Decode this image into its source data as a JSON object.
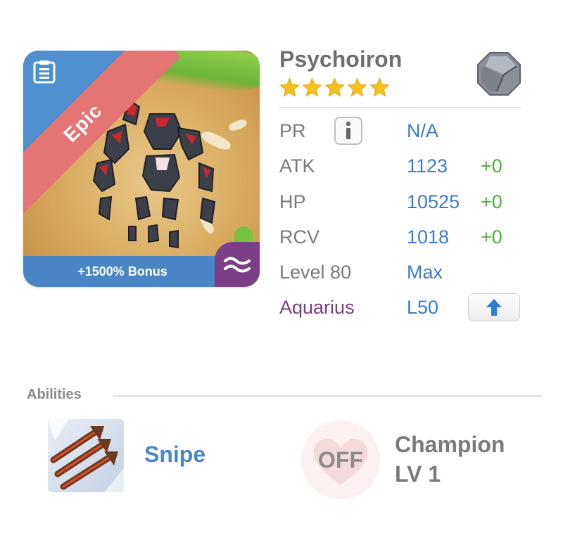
{
  "card": {
    "rarity": "Epic",
    "bonus": "+1500% Bonus",
    "element_icon": "water-waves-icon",
    "colors": {
      "rarity_ribbon": "#e57474",
      "corner": "#4d8fcf",
      "bonus_bar": "#4a86c6",
      "element_tab": "#7b3f86"
    }
  },
  "monster": {
    "name": "Psychoiron",
    "stars": 5,
    "type_icon": "metal-gem-icon"
  },
  "stats": {
    "pr": {
      "label": "PR",
      "value": "N/A"
    },
    "atk": {
      "label": "ATK",
      "value": "1123",
      "bonus": "+0"
    },
    "hp": {
      "label": "HP",
      "value": "10525",
      "bonus": "+0"
    },
    "rcv": {
      "label": "RCV",
      "value": "1018",
      "bonus": "+0"
    },
    "level": {
      "label": "Level 80",
      "value": "Max"
    },
    "sign": {
      "label": "Aquarius",
      "value": "L50"
    }
  },
  "abilities": {
    "title": "Abilities",
    "skill": {
      "name": "Snipe",
      "icon": "triple-arrow-icon"
    },
    "champion": {
      "status": "OFF",
      "name": "Champion",
      "level": "LV 1"
    }
  }
}
